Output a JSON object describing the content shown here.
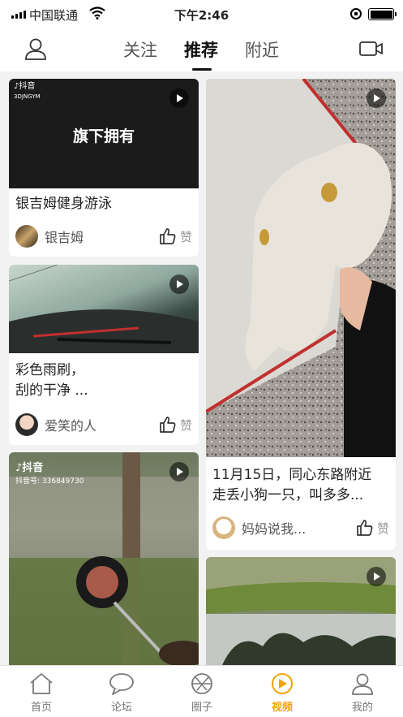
{
  "status_bar": {
    "carrier": "中国联通",
    "time": "下午2:46"
  },
  "header": {
    "tabs": [
      {
        "label": "关注",
        "active": false
      },
      {
        "label": "推荐",
        "active": true
      },
      {
        "label": "附近",
        "active": false
      }
    ]
  },
  "feed": [
    {
      "thumb_overlay_text": "旗下拥有",
      "tiktok_brand": "抖音",
      "overlay_small": "3DJNGYM",
      "title": "银吉姆健身游泳",
      "author": "银吉姆",
      "like_label": "赞"
    },
    {
      "title_line1": "彩色雨刷，",
      "title_line2": "刮的干净 ...",
      "author": "爱笑的人",
      "like_label": "赞"
    },
    {
      "tiktok_brand": "抖音",
      "tiktok_id": "抖音号: 336849730"
    },
    {
      "title_line1": "11月15日，同心东路附近",
      "title_line2": "走丢小狗一只，叫多多...",
      "author": "妈妈说我...",
      "like_label": "赞"
    },
    {}
  ],
  "bottom_nav": [
    {
      "label": "首页",
      "icon": "home-icon",
      "active": false
    },
    {
      "label": "论坛",
      "icon": "forum-icon",
      "active": false
    },
    {
      "label": "圈子",
      "icon": "circle-icon",
      "active": false
    },
    {
      "label": "视频",
      "icon": "video-play-icon",
      "active": true
    },
    {
      "label": "我的",
      "icon": "profile-icon",
      "active": false
    }
  ],
  "colors": {
    "accent": "#f2a40c",
    "text": "#222222",
    "muted": "#999999",
    "background": "#f2f2f2"
  }
}
